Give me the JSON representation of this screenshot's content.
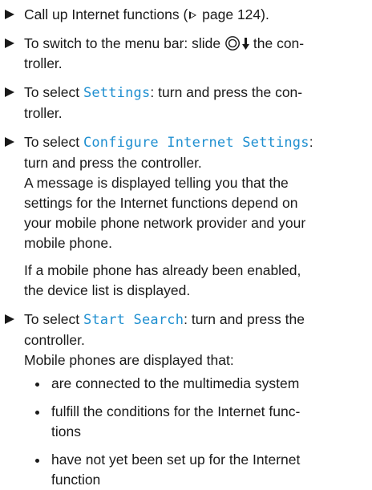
{
  "steps": [
    {
      "lines": [
        "Call up Internet functions (",
        "page 124)."
      ]
    },
    {
      "lines": [
        "To switch to the menu bar: slide",
        "the con-",
        "troller."
      ]
    },
    {
      "pre": "To select ",
      "ui": "Settings",
      "post": ": turn and press the con-",
      "line2": "troller."
    },
    {
      "pre": "To select ",
      "ui": "Configure Internet Settings",
      "post": ":",
      "lines": [
        "turn and press the controller.",
        "A message is displayed telling you that the",
        "settings for the Internet functions depend on",
        "your mobile phone network provider and your",
        "mobile phone."
      ]
    },
    {
      "pre": "To select ",
      "ui": "Start Search",
      "post": ": turn and press the",
      "lines": [
        "controller.",
        "Mobile phones are displayed that:"
      ]
    }
  ],
  "note": {
    "lines": [
      "If a mobile phone has already been enabled,",
      "the device list is displayed."
    ]
  },
  "bullets": [
    {
      "lines": [
        "are connected to the multimedia system"
      ]
    },
    {
      "lines": [
        "fulfill the conditions for the Internet func-",
        "tions"
      ]
    },
    {
      "lines": [
        "have not yet been set up for the Internet",
        "function"
      ]
    }
  ],
  "colors": {
    "ui_term": "#1f8fd0",
    "text": "#1a1a1a"
  },
  "icons": {
    "step_marker": "right-triangle-icon",
    "controller": "controller-slide-down-icon",
    "page_ref": "page-reference-triangle-icon"
  }
}
